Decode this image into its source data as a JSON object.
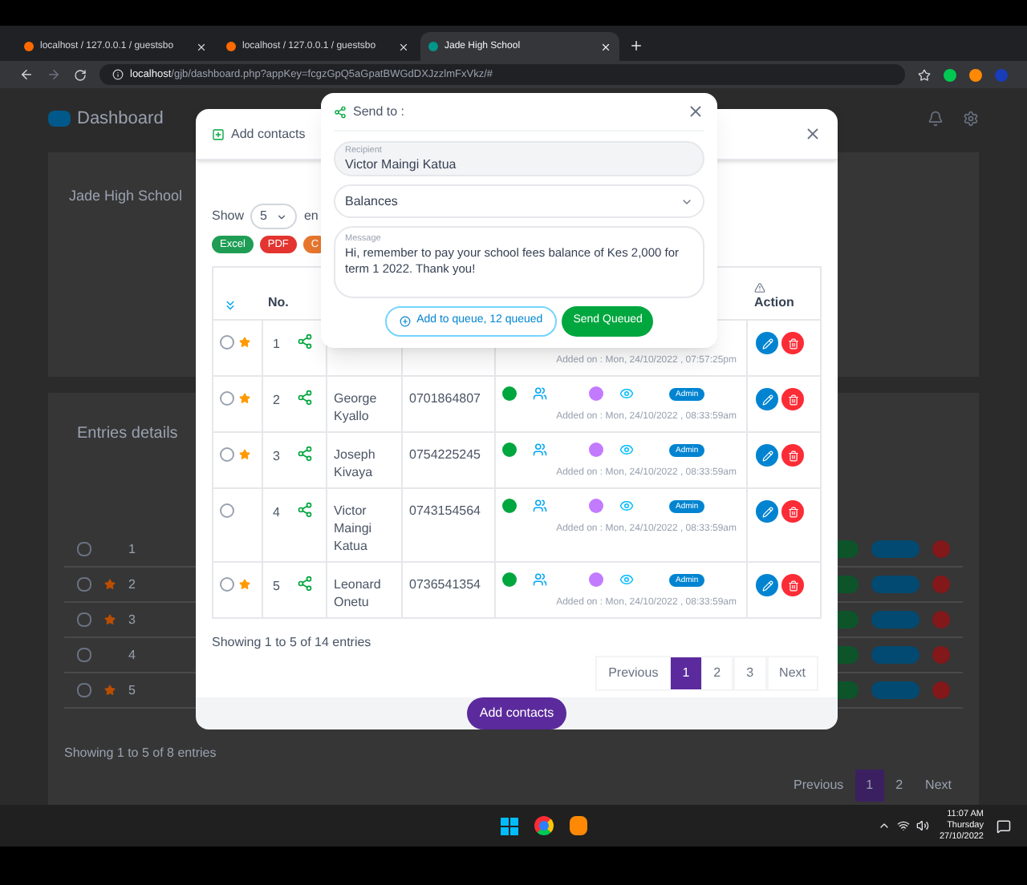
{
  "browser": {
    "tabs": [
      {
        "title": "localhost / 127.0.0.1 / guestsbo",
        "selected": false
      },
      {
        "title": "localhost / 127.0.0.1 / guestsbo",
        "selected": false
      },
      {
        "title": "Jade High School",
        "selected": true
      }
    ],
    "url_host": "localhost",
    "url_path": "/gjb/dashboard.php?appKey=fcgzGpQ5aGpatBWGdDXJzzlmFxVkz/#"
  },
  "page": {
    "brand": "Dashboard",
    "school": "Jade High School",
    "entries_title": "Entries details",
    "rows": [
      {
        "no": "1",
        "starred": false,
        "selected": false
      },
      {
        "no": "2",
        "starred": true,
        "selected": false
      },
      {
        "no": "3",
        "starred": true,
        "selected": false
      },
      {
        "no": "4",
        "starred": false,
        "selected": false
      },
      {
        "no": "5",
        "starred": true,
        "selected": false
      }
    ],
    "footer": "Showing 1 to 5 of 8 entries",
    "pagination": [
      {
        "label": "Previous",
        "selected": false
      },
      {
        "label": "1",
        "selected": true
      },
      {
        "label": "2",
        "selected": false
      },
      {
        "label": "Next",
        "selected": false
      }
    ]
  },
  "add_modal": {
    "title": "Add contacts",
    "show_label": "Show",
    "page_size": "5",
    "entries_label": "en",
    "export_buttons": [
      {
        "label": "Excel",
        "color": "#1f9d55"
      },
      {
        "label": "PDF",
        "color": "#e3342f"
      },
      {
        "label": "C",
        "color": "#e8772e"
      }
    ],
    "columns": {
      "no": "No.",
      "action": "Action"
    },
    "rows": [
      {
        "no": "1",
        "date": "Added on : Mon, 24/10/2022 , 07:57:25pm",
        "starred": true,
        "selected": false
      },
      {
        "no": "2",
        "name": "George Kyallo",
        "phone": "0701864807",
        "date": "Added on : Mon, 24/10/2022 , 08:33:59am",
        "starred": true,
        "selected": false,
        "badge": "Admin"
      },
      {
        "no": "3",
        "name": "Joseph Kivaya",
        "phone": "0754225245",
        "date": "Added on : Mon, 24/10/2022 , 08:33:59am",
        "starred": true,
        "selected": false,
        "badge": "Admin"
      },
      {
        "no": "4",
        "name": "Victor Maingi Katua",
        "phone": "0743154564",
        "date": "Added on : Mon, 24/10/2022 , 08:33:59am",
        "starred": false,
        "selected": false,
        "badge": "Admin"
      },
      {
        "no": "5",
        "name": "Leonard Onetu",
        "phone": "0736541354",
        "date": "Added on : Mon, 24/10/2022 , 08:33:59am",
        "starred": true,
        "selected": false,
        "badge": "Admin"
      }
    ],
    "footer": "Showing 1 to 5 of 14 entries",
    "pagination": [
      {
        "label": "Previous",
        "selected": false
      },
      {
        "label": "1",
        "selected": true
      },
      {
        "label": "2",
        "selected": false
      },
      {
        "label": "3",
        "selected": false
      },
      {
        "label": "Next",
        "selected": false
      }
    ],
    "submit": "Add contacts"
  },
  "send_modal": {
    "title": "Send to :",
    "recipient_label": "Recipient",
    "recipient": "Victor Maingi Katua",
    "template": "Balances",
    "message_label": "Message",
    "message": "Hi, remember to pay your school fees balance of Kes 2,000 for term 1 2022. Thank you!",
    "queue_button": "Add to queue, 12 queued",
    "send_button": "Send Queued"
  },
  "taskbar": {
    "time": "11:07 AM",
    "day": "Thursday",
    "date": "27/10/2022"
  }
}
